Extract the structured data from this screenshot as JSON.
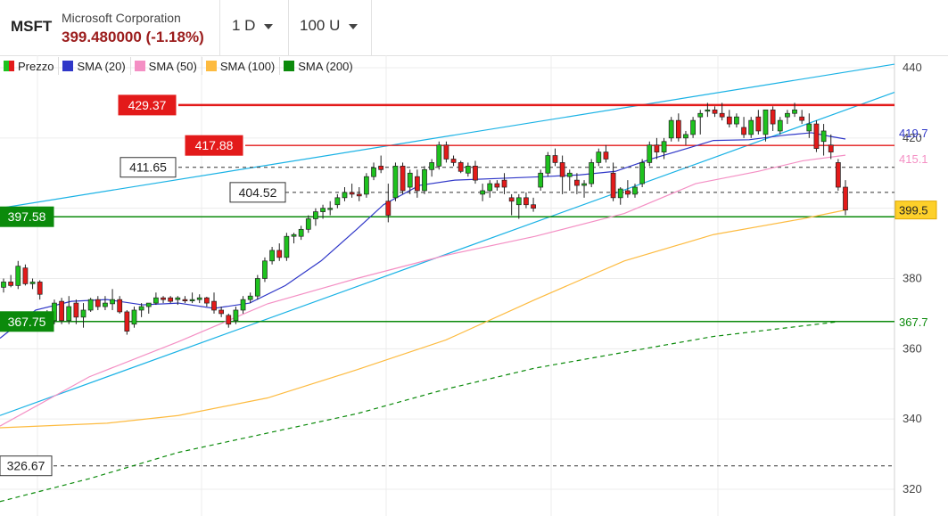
{
  "header": {
    "symbol": "MSFT",
    "company": "Microsoft Corporation",
    "price": "399.480000 (-1.18%)",
    "interval": "1 D",
    "bars": "100 U"
  },
  "colors": {
    "up": "#1ec21e",
    "down": "#e31a1a",
    "sma20": "#2f37c8",
    "sma50": "#f48fc4",
    "sma100": "#fdbb40",
    "sma200": "#0b8a0b",
    "trend": "#1ab2e5",
    "support": "#0b8a0b",
    "resistance": "#e31a1a",
    "dashed": "#333333"
  },
  "chart_data": {
    "type": "candlestick",
    "ylim": [
      314,
      448
    ],
    "y_ticks": [
      440,
      420,
      400,
      380,
      360,
      340,
      320
    ],
    "legend": [
      "Prezzo",
      "SMA (20)",
      "SMA (50)",
      "SMA (100)",
      "SMA (200)"
    ],
    "candles": [
      [
        377.5,
        380,
        376,
        379
      ],
      [
        379,
        381,
        377.5,
        378
      ],
      [
        378,
        385,
        377,
        383.5
      ],
      [
        383,
        384,
        378,
        378.5
      ],
      [
        378.5,
        380,
        377,
        379
      ],
      [
        379,
        379.5,
        374,
        375.5
      ],
      [
        368,
        371,
        365,
        366
      ],
      [
        368,
        374,
        367,
        373
      ],
      [
        373.5,
        374.5,
        367,
        368
      ],
      [
        368,
        375,
        367,
        372
      ],
      [
        373,
        374,
        367,
        369
      ],
      [
        369,
        373,
        366,
        371
      ],
      [
        371,
        374.5,
        370.5,
        374
      ],
      [
        374,
        375,
        371,
        372
      ],
      [
        372,
        375,
        371,
        373
      ],
      [
        372.8,
        377,
        371,
        374
      ],
      [
        374,
        375,
        370,
        370.5
      ],
      [
        370.5,
        371,
        364,
        365
      ],
      [
        367,
        372,
        366,
        371
      ],
      [
        371,
        373,
        369,
        372
      ],
      [
        372,
        373,
        370,
        373
      ],
      [
        373,
        376,
        372.5,
        374.5
      ],
      [
        374.5,
        375,
        373,
        374
      ],
      [
        374.5,
        375,
        373,
        373.5
      ],
      [
        374,
        375,
        372.5,
        374.5
      ],
      [
        374,
        375,
        373,
        373.7
      ],
      [
        374,
        376,
        373,
        374
      ],
      [
        374,
        375.5,
        373,
        374.5
      ],
      [
        374.5,
        374.8,
        372,
        373
      ],
      [
        373.5,
        376,
        370,
        371
      ],
      [
        371,
        372,
        369,
        370
      ],
      [
        369.5,
        370,
        366,
        367
      ],
      [
        368,
        372,
        367,
        371
      ],
      [
        371,
        375,
        370,
        374
      ],
      [
        374,
        376,
        373,
        375
      ],
      [
        375,
        381,
        374,
        380
      ],
      [
        380,
        386,
        379,
        385
      ],
      [
        385,
        389,
        384,
        388
      ],
      [
        388,
        390,
        385,
        386
      ],
      [
        386,
        393,
        385,
        392
      ],
      [
        392,
        393,
        390,
        392.5
      ],
      [
        392,
        395,
        391,
        394
      ],
      [
        394,
        398,
        393,
        397
      ],
      [
        397,
        400,
        395,
        399
      ],
      [
        399,
        401,
        397,
        400
      ],
      [
        400,
        402,
        398,
        400
      ],
      [
        401,
        404,
        400,
        403
      ],
      [
        403,
        406,
        402,
        404.5
      ],
      [
        404.5,
        407,
        403,
        404
      ],
      [
        404,
        406,
        402,
        403.5
      ],
      [
        404,
        410,
        403,
        409
      ],
      [
        409,
        413,
        408,
        411.5
      ],
      [
        412,
        415,
        410,
        411
      ],
      [
        402,
        407,
        396,
        398
      ],
      [
        403,
        413,
        402,
        412
      ],
      [
        412,
        413,
        404,
        405
      ],
      [
        406,
        411,
        404,
        410
      ],
      [
        409,
        411,
        403,
        405
      ],
      [
        405,
        412,
        404,
        411
      ],
      [
        411,
        414,
        409,
        413
      ],
      [
        412,
        419,
        411,
        418
      ],
      [
        418,
        419,
        413,
        414
      ],
      [
        414,
        415,
        412,
        413
      ],
      [
        413,
        413.5,
        410,
        410.5
      ],
      [
        410,
        413,
        409,
        412
      ],
      [
        412,
        413.5,
        407,
        408
      ],
      [
        404,
        407,
        402,
        405
      ],
      [
        405,
        408,
        403,
        407
      ],
      [
        407,
        408,
        405,
        406
      ],
      [
        408,
        410,
        404,
        406
      ],
      [
        403,
        404,
        398,
        402
      ],
      [
        401,
        404,
        397,
        403
      ],
      [
        403,
        404.5,
        400,
        401
      ],
      [
        401,
        403,
        399,
        400
      ],
      [
        406,
        411,
        405,
        410
      ],
      [
        410,
        416,
        409,
        415
      ],
      [
        415,
        417,
        412,
        413
      ],
      [
        413,
        415,
        404,
        409
      ],
      [
        409,
        411,
        405,
        410
      ],
      [
        408,
        410,
        404,
        406.5
      ],
      [
        406.5,
        408,
        403,
        407
      ],
      [
        407,
        414,
        406,
        413
      ],
      [
        413,
        417,
        412,
        416
      ],
      [
        416,
        418,
        413,
        414
      ],
      [
        410,
        413,
        402,
        403
      ],
      [
        403,
        406,
        401,
        405.5
      ],
      [
        405,
        408,
        403,
        404
      ],
      [
        404,
        407,
        403,
        406
      ],
      [
        407,
        414,
        406,
        413
      ],
      [
        413,
        419,
        412,
        418
      ],
      [
        418,
        420,
        414,
        416
      ],
      [
        416,
        420,
        414,
        419
      ],
      [
        420,
        426,
        419,
        425
      ],
      [
        425,
        427,
        419,
        420
      ],
      [
        420,
        422,
        418,
        421
      ],
      [
        421,
        426,
        420,
        425
      ],
      [
        426,
        428,
        421,
        427
      ],
      [
        428,
        430,
        426,
        428
      ],
      [
        428,
        429,
        426,
        427
      ],
      [
        427,
        430,
        425,
        426
      ],
      [
        426,
        428,
        423,
        424
      ],
      [
        424,
        427,
        423,
        426
      ],
      [
        423,
        426,
        420,
        421
      ],
      [
        421,
        426,
        420,
        425
      ],
      [
        426,
        428,
        421,
        422
      ],
      [
        421,
        428,
        419,
        428
      ],
      [
        428,
        429,
        422,
        424
      ],
      [
        422,
        426,
        421,
        425
      ],
      [
        426,
        428,
        424,
        427
      ],
      [
        427,
        430,
        426,
        428
      ],
      [
        426,
        428,
        424,
        425
      ],
      [
        422,
        427,
        420,
        424
      ],
      [
        424,
        425,
        416,
        417
      ],
      [
        419,
        424,
        415,
        422
      ],
      [
        418,
        421,
        414,
        416
      ],
      [
        413,
        414,
        405,
        406
      ],
      [
        406,
        408,
        398,
        399.5
      ]
    ],
    "sma20": [
      [
        0,
        363
      ],
      [
        40,
        371
      ],
      [
        80,
        373.5
      ],
      [
        120,
        374
      ],
      [
        160,
        372.5
      ],
      [
        200,
        373
      ],
      [
        240,
        371.5
      ],
      [
        280,
        373
      ],
      [
        320,
        378
      ],
      [
        360,
        385
      ],
      [
        400,
        394
      ],
      [
        430,
        401
      ],
      [
        470,
        406.5
      ],
      [
        510,
        408
      ],
      [
        560,
        408.5
      ],
      [
        610,
        409
      ],
      [
        650,
        409.5
      ],
      [
        690,
        410.5
      ],
      [
        730,
        414
      ],
      [
        770,
        417
      ],
      [
        800,
        419.3
      ],
      [
        840,
        419.5
      ],
      [
        880,
        420.8
      ],
      [
        910,
        421.5
      ],
      [
        930,
        420.5
      ],
      [
        948,
        419.7
      ]
    ],
    "sma50": [
      [
        0,
        338
      ],
      [
        100,
        352
      ],
      [
        200,
        362
      ],
      [
        300,
        372.8
      ],
      [
        400,
        380
      ],
      [
        500,
        386.6
      ],
      [
        600,
        392
      ],
      [
        700,
        398.5
      ],
      [
        780,
        407
      ],
      [
        850,
        410.5
      ],
      [
        900,
        413.5
      ],
      [
        948,
        415.1
      ]
    ],
    "sma100": [
      [
        0,
        337.5
      ],
      [
        120,
        338.8
      ],
      [
        200,
        341
      ],
      [
        300,
        346
      ],
      [
        400,
        354
      ],
      [
        500,
        362.5
      ],
      [
        600,
        374
      ],
      [
        700,
        385
      ],
      [
        800,
        392.5
      ],
      [
        900,
        397
      ],
      [
        948,
        399.5
      ]
    ],
    "sma200": [
      [
        0,
        316.5
      ],
      [
        100,
        323
      ],
      [
        200,
        330.5
      ],
      [
        300,
        336
      ],
      [
        400,
        341.5
      ],
      [
        500,
        348.5
      ],
      [
        600,
        354.5
      ],
      [
        700,
        359
      ],
      [
        800,
        363.5
      ],
      [
        900,
        366.5
      ],
      [
        940,
        367.7
      ]
    ],
    "hlines": [
      {
        "label": "429.37",
        "value": 429.37,
        "style": "resistance"
      },
      {
        "label": "417.88",
        "value": 417.88,
        "style": "resistance-thin"
      },
      {
        "label": "411.65",
        "value": 411.65,
        "style": "dashed"
      },
      {
        "label": "404.52",
        "value": 404.52,
        "style": "dashed"
      },
      {
        "label": "397.58",
        "value": 397.58,
        "style": "support"
      },
      {
        "label": "367.75",
        "value": 367.75,
        "style": "support"
      },
      {
        "label": "326.67",
        "value": 326.67,
        "style": "dashed"
      }
    ],
    "trendlines": [
      {
        "from": [
          0,
          400
        ],
        "to": [
          1003,
          441
        ]
      },
      {
        "from": [
          0,
          341
        ],
        "to": [
          1003,
          433
        ]
      }
    ],
    "right_tags": [
      {
        "label": "419.7",
        "value": 419.7,
        "kind": "sma20"
      },
      {
        "label": "415.1",
        "value": 415.1,
        "kind": "sma50"
      },
      {
        "label": "399.5",
        "value": 399.5,
        "kind": "sma100"
      },
      {
        "label": "367.7",
        "value": 367.7,
        "kind": "sma200"
      }
    ]
  }
}
